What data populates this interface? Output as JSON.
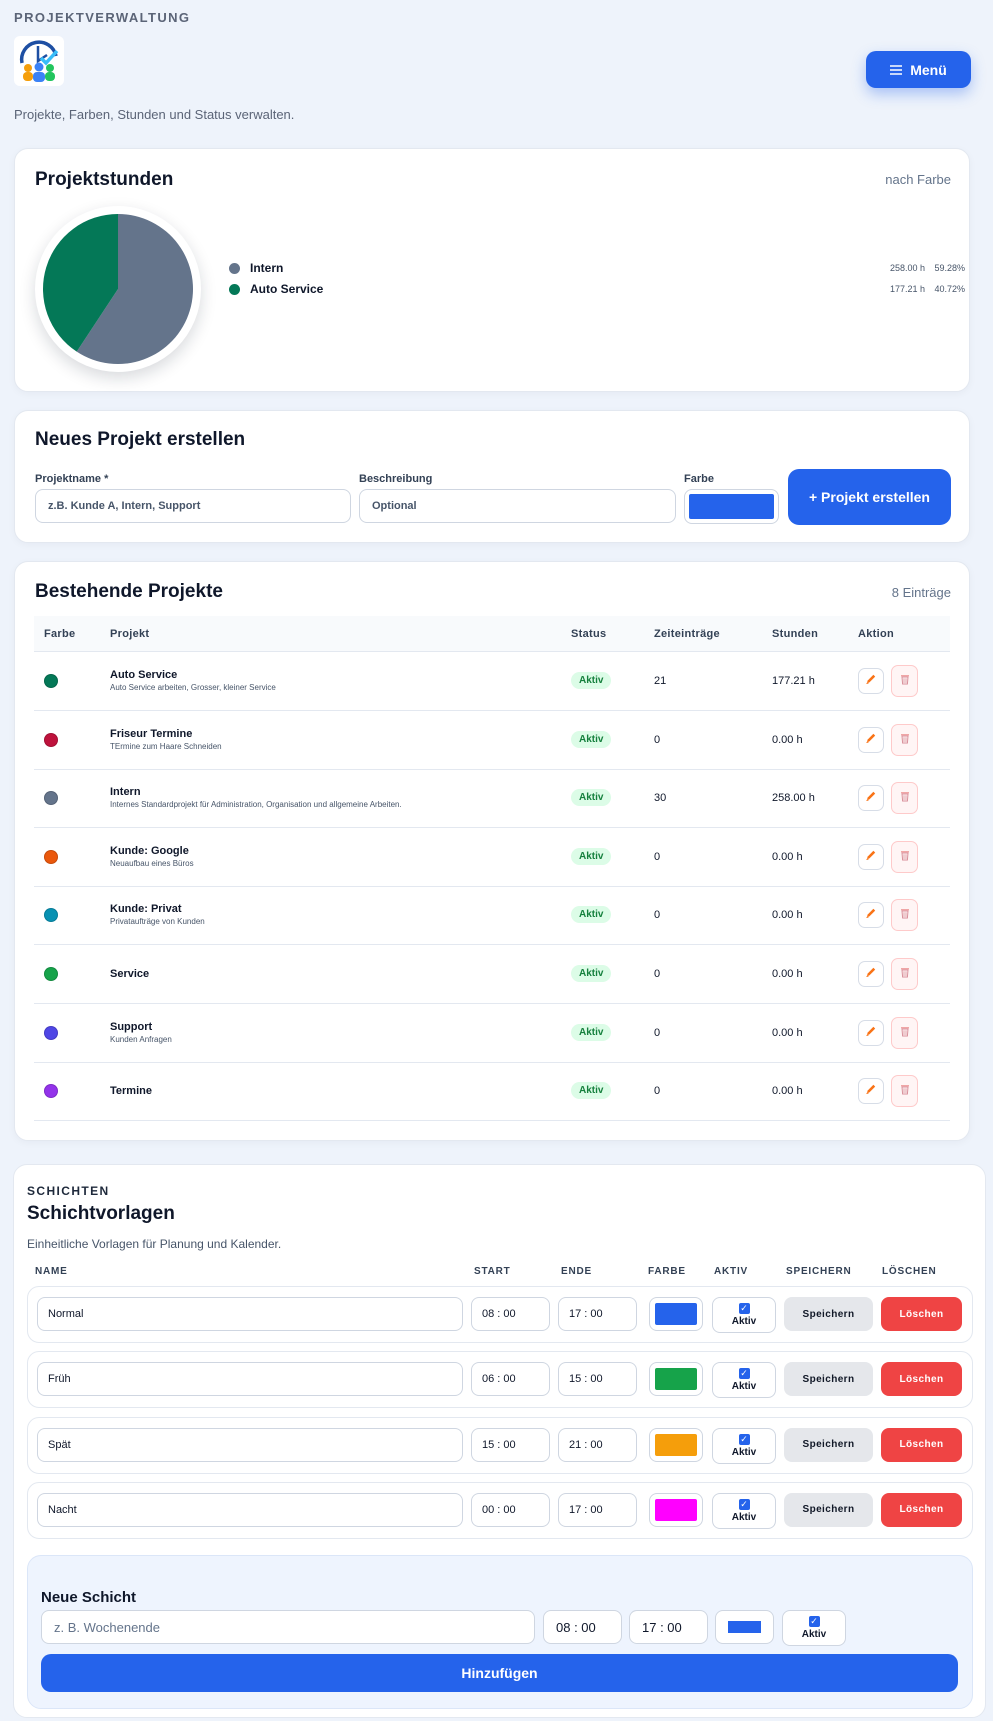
{
  "header": {
    "eyebrow": "PROJEKTVERWALTUNG",
    "subtitle": "Projekte, Farben, Stunden und Status verwalten.",
    "menu_label": "Menü"
  },
  "hours_card": {
    "title": "Projektstunden",
    "meta": "nach Farbe"
  },
  "chart_data": {
    "type": "pie",
    "slices": [
      {
        "name": "Intern",
        "hours": "258.00 h",
        "percent_label": "59.28%",
        "value": 59.28,
        "color": "#64748b"
      },
      {
        "name": "Auto Service",
        "hours": "177.21 h",
        "percent_label": "40.72%",
        "value": 40.72,
        "color": "#047857"
      }
    ]
  },
  "new_project": {
    "title": "Neues Projekt erstellen",
    "name_label": "Projektname *",
    "name_placeholder": "z.B. Kunde A, Intern, Support",
    "desc_label": "Beschreibung",
    "desc_placeholder": "Optional",
    "color_label": "Farbe",
    "color_value": "#2563eb",
    "create_label": "+ Projekt erstellen"
  },
  "projects": {
    "title": "Bestehende Projekte",
    "count": "8 Einträge",
    "columns": [
      "Farbe",
      "Projekt",
      "Status",
      "Zeiteinträge",
      "Stunden",
      "Aktion"
    ],
    "rows": [
      {
        "name": "Auto Service",
        "desc": "Auto Service arbeiten, Grosser, kleiner Service",
        "status": "Aktiv",
        "entries": "21",
        "hours": "177.21 h",
        "color": "#047857"
      },
      {
        "name": "Friseur Termine",
        "desc": "TErmine zum Haare Schneiden",
        "status": "Aktiv",
        "entries": "0",
        "hours": "0.00 h",
        "color": "#be123c"
      },
      {
        "name": "Intern",
        "desc": "Internes Standardprojekt für Administration, Organisation und allgemeine Arbeiten.",
        "status": "Aktiv",
        "entries": "30",
        "hours": "258.00 h",
        "color": "#64748b"
      },
      {
        "name": "Kunde: Google",
        "desc": "Neuaufbau eines Büros",
        "status": "Aktiv",
        "entries": "0",
        "hours": "0.00 h",
        "color": "#ea580c"
      },
      {
        "name": "Kunde: Privat",
        "desc": "Privataufträge von Kunden",
        "status": "Aktiv",
        "entries": "0",
        "hours": "0.00 h",
        "color": "#0891b2"
      },
      {
        "name": "Service",
        "desc": "",
        "status": "Aktiv",
        "entries": "0",
        "hours": "0.00 h",
        "color": "#16a34a"
      },
      {
        "name": "Support",
        "desc": "Kunden Anfragen",
        "status": "Aktiv",
        "entries": "0",
        "hours": "0.00 h",
        "color": "#4f46e5"
      },
      {
        "name": "Termine",
        "desc": "",
        "status": "Aktiv",
        "entries": "0",
        "hours": "0.00 h",
        "color": "#9333ea"
      }
    ]
  },
  "shifts": {
    "eyebrow": "SCHICHTEN",
    "title": "Schichtvorlagen",
    "subtitle": "Einheitliche Vorlagen für Planung und Kalender.",
    "columns": [
      "NAME",
      "START",
      "ENDE",
      "FARBE",
      "AKTIV",
      "SPEICHERN",
      "LÖSCHEN"
    ],
    "rows": [
      {
        "name": "Normal",
        "start": "08 : 00",
        "end": "17 : 00",
        "color": "#2563eb",
        "active_label": "Aktiv",
        "save_label": "Speichern",
        "delete_label": "Löschen"
      },
      {
        "name": "Früh",
        "start": "06 : 00",
        "end": "15 : 00",
        "color": "#16a34a",
        "active_label": "Aktiv",
        "save_label": "Speichern",
        "delete_label": "Löschen"
      },
      {
        "name": "Spät",
        "start": "15 : 00",
        "end": "21 : 00",
        "color": "#f59e0b",
        "active_label": "Aktiv",
        "save_label": "Speichern",
        "delete_label": "Löschen"
      },
      {
        "name": "Nacht",
        "start": "00 : 00",
        "end": "17 : 00",
        "color": "#ff00ff",
        "active_label": "Aktiv",
        "save_label": "Speichern",
        "delete_label": "Löschen"
      }
    ],
    "new_shift": {
      "title": "Neue Schicht",
      "name_placeholder": "z. B. Wochenende",
      "start": "08 : 00",
      "end": "17 : 00",
      "color": "#2563eb",
      "active_label": "Aktiv",
      "add_label": "Hinzufügen"
    }
  }
}
